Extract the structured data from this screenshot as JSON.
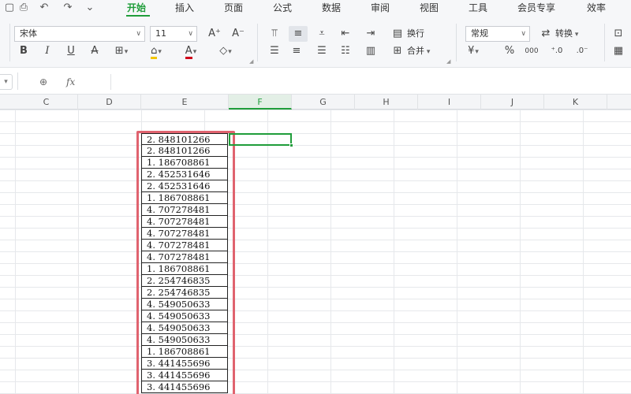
{
  "menu": {
    "quick_access": [
      {
        "name": "save-icon",
        "glyph": "▢"
      },
      {
        "name": "print-preview-icon",
        "glyph": "⎙"
      },
      {
        "name": "undo-icon",
        "glyph": "↶"
      },
      {
        "name": "redo-icon",
        "glyph": "↷"
      },
      {
        "name": "more-icon",
        "glyph": "⌄"
      }
    ],
    "tabs": [
      "开始",
      "插入",
      "页面",
      "公式",
      "数据",
      "审阅",
      "视图",
      "工具",
      "会员专享",
      "效率"
    ],
    "active_tab": "开始",
    "accent_color": "#1f9d3a"
  },
  "ribbon": {
    "font_name": "宋体",
    "font_size": "11",
    "number_format": "常规",
    "wrap_text_label": "换行",
    "merge_label": "合并",
    "convert_label": "转换",
    "currency_symbol": "¥",
    "percent_symbol": "%",
    "thousands_label": "000",
    "increase_font_glyph": "A⁺",
    "decrease_font_glyph": "A⁻",
    "bold_glyph": "B",
    "italic_glyph": "I",
    "underline_glyph": "U",
    "strike_glyph": "A"
  },
  "formula_bar": {
    "zoom_icon": "⊕",
    "fx_label": "fx",
    "value": ""
  },
  "grid": {
    "columns": [
      "C",
      "D",
      "E",
      "F",
      "G",
      "H",
      "I",
      "J",
      "K"
    ],
    "active_column": "F",
    "column_e_values": [
      "2. 848101266",
      "2. 848101266",
      "1. 186708861",
      "2. 452531646",
      "2. 452531646",
      "1. 186708861",
      "4. 707278481",
      "4. 707278481",
      "4. 707278481",
      "4. 707278481",
      "4. 707278481",
      "1. 186708861",
      "2. 254746835",
      "2. 254746835",
      "4. 549050633",
      "4. 549050633",
      "4. 549050633",
      "4. 549050633",
      "1. 186708861",
      "3. 441455696",
      "3. 441455696",
      "3. 441455696"
    ],
    "highlight_color": "#e0636f",
    "selection_color": "#1f9d3a"
  }
}
